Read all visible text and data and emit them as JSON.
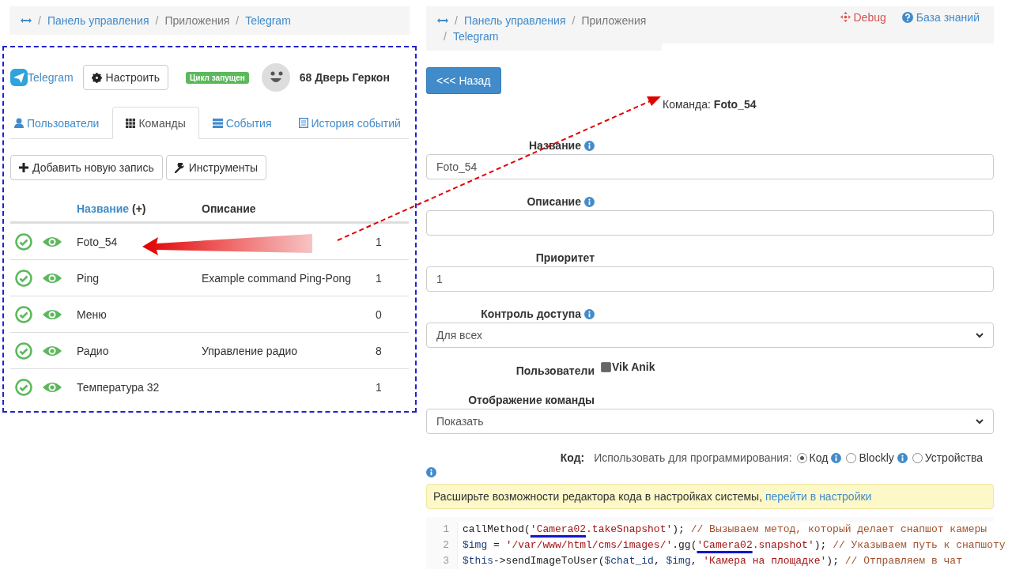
{
  "left": {
    "breadcrumb": [
      {
        "separator": "/",
        "label": "Панель управления",
        "link": true
      },
      {
        "separator": "/",
        "label": "Приложения",
        "link": false
      },
      {
        "separator": "/",
        "label": "Telegram",
        "link": true
      }
    ],
    "header": {
      "app_link": "Telegram",
      "configure_button": "Настроить",
      "status_badge": "Цикл запущен",
      "device_name": "68 Дверь Геркон"
    },
    "tabs": [
      {
        "label": "Пользователи",
        "selected": false
      },
      {
        "label": "Команды",
        "selected": true
      },
      {
        "label": "События",
        "selected": false
      },
      {
        "label": "История событий",
        "selected": false
      }
    ],
    "buttons": [
      {
        "label": "Добавить новую запись"
      },
      {
        "label": "Инструменты"
      }
    ],
    "table": {
      "columns": [
        {
          "label": "Название",
          "suffix": "(+)",
          "link": true
        },
        {
          "label": "Описание",
          "link": false
        }
      ],
      "rows": [
        {
          "name": "Foto_54",
          "column_3": "1"
        },
        {
          "name": "Ping",
          "description": "Example command Ping-Pong",
          "column_3": "1"
        },
        {
          "name": "Меню",
          "column_3": "0"
        },
        {
          "name": "Радио",
          "description": "Управление радио",
          "column_3": "8"
        },
        {
          "name": "Температура 32",
          "column_3": "1"
        }
      ]
    }
  },
  "right": {
    "breadcrumb": [
      {
        "separator": "/",
        "label": "Панель управления",
        "link": true
      },
      {
        "separator": "/",
        "label": "Приложения",
        "link": false
      },
      {
        "separator": "/",
        "label": "Telegram",
        "link": true
      }
    ],
    "debug_link": "Debug",
    "knowledge_link": "База знаний",
    "back_button": "<<< Назад",
    "command_title": "Команда: **Foto_54**",
    "fields": [
      {
        "kind": "text",
        "label": "Название",
        "info": true,
        "value": "Foto_54"
      },
      {
        "kind": "text",
        "label": "Описание",
        "info": true
      },
      {
        "kind": "text",
        "label": "Приоритет",
        "info": false,
        "value": "1"
      },
      {
        "kind": "select",
        "label": "Контроль доступа",
        "info": true,
        "value": "Для всех"
      },
      {
        "kind": "checkbox",
        "label": "Пользователи",
        "info": false,
        "option": "Vik Anik",
        "checked": true
      },
      {
        "kind": "select",
        "label": "Отображение команды",
        "info": false,
        "value": "Показать"
      }
    ],
    "code_mode": {
      "label": "Код:",
      "prompt": "Использовать для программирования:",
      "options": [
        {
          "label": "Код",
          "selected": true,
          "info": true
        },
        {
          "label": "Blockly",
          "selected": false,
          "info": true
        },
        {
          "label": "Устройства",
          "selected": false,
          "info": false
        }
      ]
    },
    "notice": {
      "text": "Расширьте возможности редактора кода в настройках системы,",
      "link": "перейти в настройки"
    },
    "code": [
      {
        "number": "1",
        "tokens": [
          {
            "kind": "plain",
            "text": "callMethod("
          },
          {
            "kind": "string",
            "text": "'Camera02",
            "underlined": true
          },
          {
            "kind": "string",
            "text": ".takeSnapshot'"
          },
          {
            "kind": "plain",
            "text": "); "
          },
          {
            "kind": "comment",
            "text": "// Вызываем метод, который делает снапшот камеры"
          }
        ]
      },
      {
        "number": "2",
        "tokens": [
          {
            "kind": "var",
            "text": "$img"
          },
          {
            "kind": "plain",
            "text": " = "
          },
          {
            "kind": "string",
            "text": "'/var/www/html/cms/images/'"
          },
          {
            "kind": "plain",
            "text": ".gg("
          },
          {
            "kind": "string",
            "text": "'Camera02",
            "underlined": true
          },
          {
            "kind": "string",
            "text": ".snapshot'"
          },
          {
            "kind": "plain",
            "text": "); "
          },
          {
            "kind": "comment",
            "text": "// Указываем путь к снапшоту"
          }
        ]
      },
      {
        "number": "3",
        "tokens": [
          {
            "kind": "var",
            "text": "$this"
          },
          {
            "kind": "plain",
            "text": "->sendImageToUser("
          },
          {
            "kind": "var",
            "text": "$chat_id"
          },
          {
            "kind": "plain",
            "text": ", "
          },
          {
            "kind": "var",
            "text": "$img"
          },
          {
            "kind": "plain",
            "text": ", "
          },
          {
            "kind": "string",
            "text": "'Камера на площадке'"
          },
          {
            "kind": "plain",
            "text": "); "
          },
          {
            "kind": "comment",
            "text": "// Отправляем в чат"
          }
        ]
      }
    ]
  }
}
